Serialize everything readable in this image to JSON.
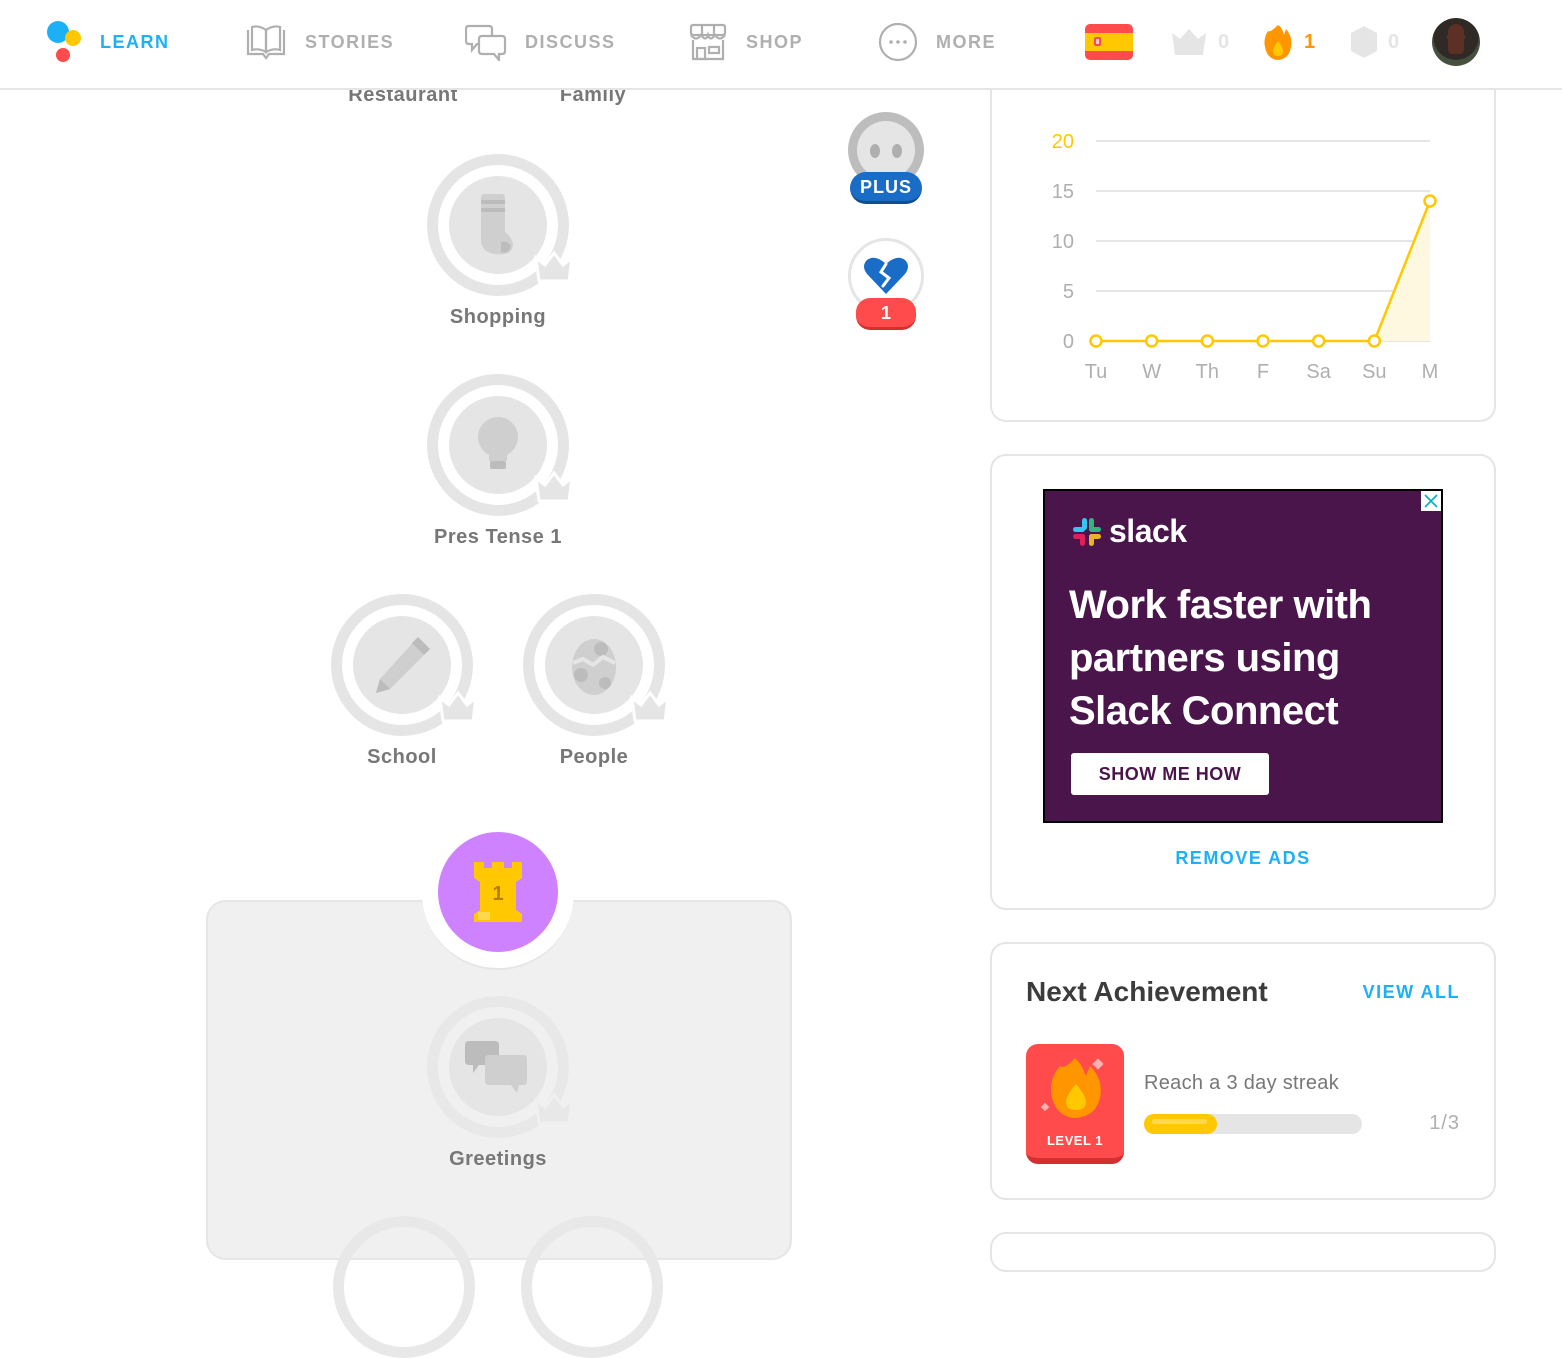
{
  "nav": {
    "items": [
      {
        "label": "LEARN",
        "icon": "duolingo-logo-icon",
        "active": true
      },
      {
        "label": "STORIES",
        "icon": "book-icon",
        "active": false
      },
      {
        "label": "DISCUSS",
        "icon": "chat-bubbles-icon",
        "active": false
      },
      {
        "label": "SHOP",
        "icon": "shop-icon",
        "active": false
      },
      {
        "label": "MORE",
        "icon": "more-dots-icon",
        "active": false
      }
    ],
    "stats": {
      "language": "Spanish",
      "crowns": "0",
      "streak": "1",
      "gems": "0"
    }
  },
  "skills": {
    "top_row": [
      "Restaurant",
      "Family"
    ],
    "shopping": "Shopping",
    "pres_tense": "Pres Tense 1",
    "school": "School",
    "people": "People",
    "greetings": "Greetings"
  },
  "checkpoint": {
    "number": "1"
  },
  "side_badges": {
    "plus_label": "PLUS",
    "hearts_count": "1"
  },
  "chart_data": {
    "type": "line",
    "title": "",
    "categories": [
      "Tu",
      "W",
      "Th",
      "F",
      "Sa",
      "Su",
      "M"
    ],
    "values": [
      0,
      0,
      0,
      0,
      0,
      0,
      14
    ],
    "yticks": [
      "0",
      "5",
      "10",
      "15",
      "20"
    ],
    "ylim": [
      0,
      20
    ],
    "xlabel": "",
    "ylabel": "",
    "grid": true,
    "color": "#ffc800",
    "highlight_tick": "20"
  },
  "ad": {
    "brand": "slack",
    "headline_lines": [
      "Work faster with",
      "partners using",
      "Slack Connect"
    ],
    "cta": "SHOW ME HOW",
    "remove_ads": "REMOVE ADS",
    "background": "#4a154b"
  },
  "achievement": {
    "title": "Next Achievement",
    "view_all": "VIEW ALL",
    "badge_level": "LEVEL 1",
    "description": "Reach a 3 day streak",
    "progress_text": "1/3",
    "progress_fraction": 0.333
  },
  "colors": {
    "accent_blue": "#1cb0f6",
    "streak_orange": "#ff9600",
    "gold": "#ffc800",
    "heart_red": "#ff4b4b",
    "plus_blue": "#1a6dc7",
    "checkpoint_purple": "#ce82ff"
  }
}
